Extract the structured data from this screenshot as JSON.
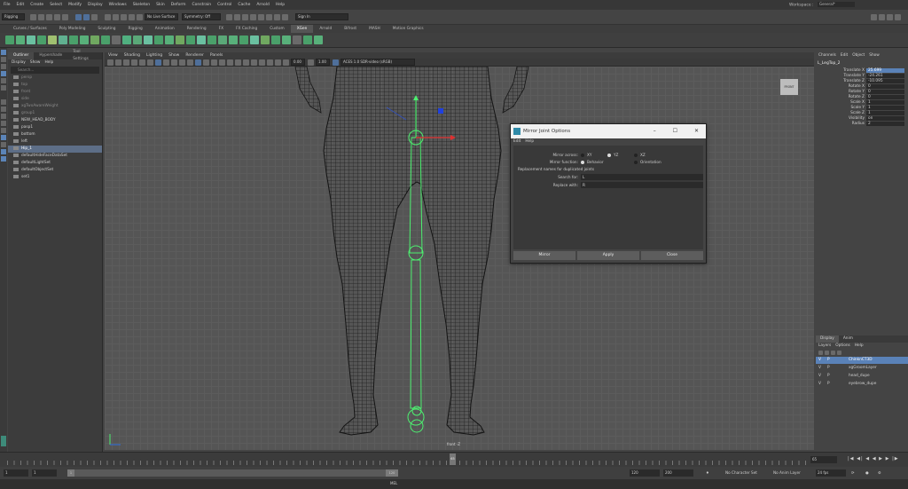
{
  "menubar": {
    "items": [
      "File",
      "Edit",
      "Create",
      "Select",
      "Modify",
      "Display",
      "Windows",
      "Skeleton",
      "Skin",
      "Deform",
      "Constrain",
      "Control",
      "Cache",
      "Arnold",
      "Help"
    ],
    "workspace_label": "Workspace :",
    "workspace_value": "General*"
  },
  "statusline": {
    "mode": "Rigging",
    "no_live_surface": "No Live Surface",
    "symmetry": "Symmetry: Off",
    "sign_in": "Sign In"
  },
  "shelf_tabs": [
    "Curves / Surfaces",
    "Poly Modeling",
    "Sculpting",
    "Rigging",
    "Animation",
    "Rendering",
    "FX",
    "FX Caching",
    "Custom",
    "XGen",
    "Arnold",
    "Bifrost",
    "MASH",
    "Motion Graphics"
  ],
  "shelf_active": "XGen",
  "outliner": {
    "tabs": [
      "Outliner",
      "Hypershade",
      "Tool Settings"
    ],
    "menu": [
      "Display",
      "Show",
      "Help"
    ],
    "search_placeholder": "Search...",
    "items": [
      {
        "label": "persp",
        "dim": true
      },
      {
        "label": "top",
        "dim": true
      },
      {
        "label": "front",
        "dim": true
      },
      {
        "label": "side",
        "dim": true
      },
      {
        "label": "xgTwoAwareWeight",
        "dim": true
      },
      {
        "label": "group1",
        "dim": true
      },
      {
        "label": "NEW_HEAD_BODY",
        "dim": false
      },
      {
        "label": "pasp1",
        "dim": false
      },
      {
        "label": "bottom",
        "dim": false
      },
      {
        "label": "left",
        "dim": false
      },
      {
        "label": "Hip_1",
        "dim": false,
        "selected": true
      },
      {
        "label": "defaultHideFaceDataSet",
        "dim": false
      },
      {
        "label": "defaultLightSet",
        "dim": false
      },
      {
        "label": "defaultObjectSet",
        "dim": false
      },
      {
        "label": "set1",
        "dim": false
      }
    ]
  },
  "viewport": {
    "menu": [
      "View",
      "Shading",
      "Lighting",
      "Show",
      "Renderer",
      "Panels"
    ],
    "exposure": "0.00",
    "gamma": "1.00",
    "colorspace": "ACES 1.0 SDR-video (sRGB)",
    "view_cube": "FRONT",
    "camera": "front -Z"
  },
  "dialog": {
    "title": "Mirror Joint Options",
    "menu": [
      "Edit",
      "Help"
    ],
    "mirror_across_label": "Mirror across:",
    "mirror_across_options": [
      "XY",
      "YZ",
      "XZ"
    ],
    "mirror_across_selected": "YZ",
    "mirror_function_label": "Mirror function:",
    "mirror_function_options": [
      "Behavior",
      "Orientation"
    ],
    "mirror_function_selected": "Behavior",
    "replacement_heading": "Replacement names for duplicated joints",
    "search_for_label": "Search for:",
    "search_for_value": "L",
    "replace_with_label": "Replace with:",
    "replace_with_value": "R",
    "buttons": [
      "Mirror",
      "Apply",
      "Close"
    ],
    "window_controls": [
      "–",
      "☐",
      "✕"
    ]
  },
  "channel_box": {
    "tabs": [
      "Channels",
      "Edit",
      "Object",
      "Show"
    ],
    "object": "L_LegTop_2",
    "channels": [
      {
        "label": "Translate X",
        "value": "25.699",
        "highlight": true
      },
      {
        "label": "Translate Y",
        "value": "-24.261"
      },
      {
        "label": "Translate Z",
        "value": "-10.095"
      },
      {
        "label": "Rotate X",
        "value": "0"
      },
      {
        "label": "Rotate Y",
        "value": "0"
      },
      {
        "label": "Rotate Z",
        "value": "0"
      },
      {
        "label": "Scale X",
        "value": "1"
      },
      {
        "label": "Scale Y",
        "value": "1"
      },
      {
        "label": "Scale Z",
        "value": "1"
      },
      {
        "label": "Visibility",
        "value": "on"
      },
      {
        "label": "Radius",
        "value": "2"
      }
    ]
  },
  "layers": {
    "tabs": [
      "Display",
      "Anim"
    ],
    "menu": [
      "Layers",
      "Options",
      "Help"
    ],
    "rows": [
      {
        "v": "V",
        "p": "P",
        "name": "ChinknCT3D",
        "selected": true
      },
      {
        "v": "V",
        "p": "P",
        "name": "xgGroomLayer"
      },
      {
        "v": "V",
        "p": "P",
        "name": "head_dupe"
      },
      {
        "v": "V",
        "p": "P",
        "name": "eyebrow_dupe"
      }
    ]
  },
  "timeslider": {
    "current_frame": "65",
    "head_label": "65"
  },
  "rangebar": {
    "start": "1",
    "start2": "1",
    "end_inner": "120",
    "end": "120",
    "max_end": "200",
    "character_set": "No Character Set",
    "anim_layer": "No Anim Layer",
    "fps": "24 fps"
  },
  "cmdline": {
    "label": "MEL"
  }
}
